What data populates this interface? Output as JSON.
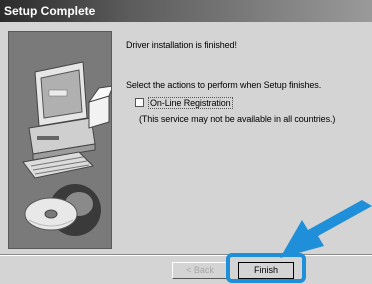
{
  "window": {
    "title": "Setup Complete"
  },
  "main": {
    "status_text": "Driver installation is finished!",
    "instruction": "Select the actions to perform when Setup finishes.",
    "registration": {
      "label": "On-Line Registration",
      "checked": false
    },
    "note": "(This service may not be available in all countries.)"
  },
  "buttons": {
    "back": "< Back",
    "finish": "Finish"
  },
  "colors": {
    "highlight": "#1e8fd8",
    "titlebar_start": "#2b2b2b",
    "titlebar_end": "#9a9a9a"
  },
  "icons": [
    "computer-illustration",
    "cd-disc-icon",
    "pointer-arrow-icon"
  ]
}
